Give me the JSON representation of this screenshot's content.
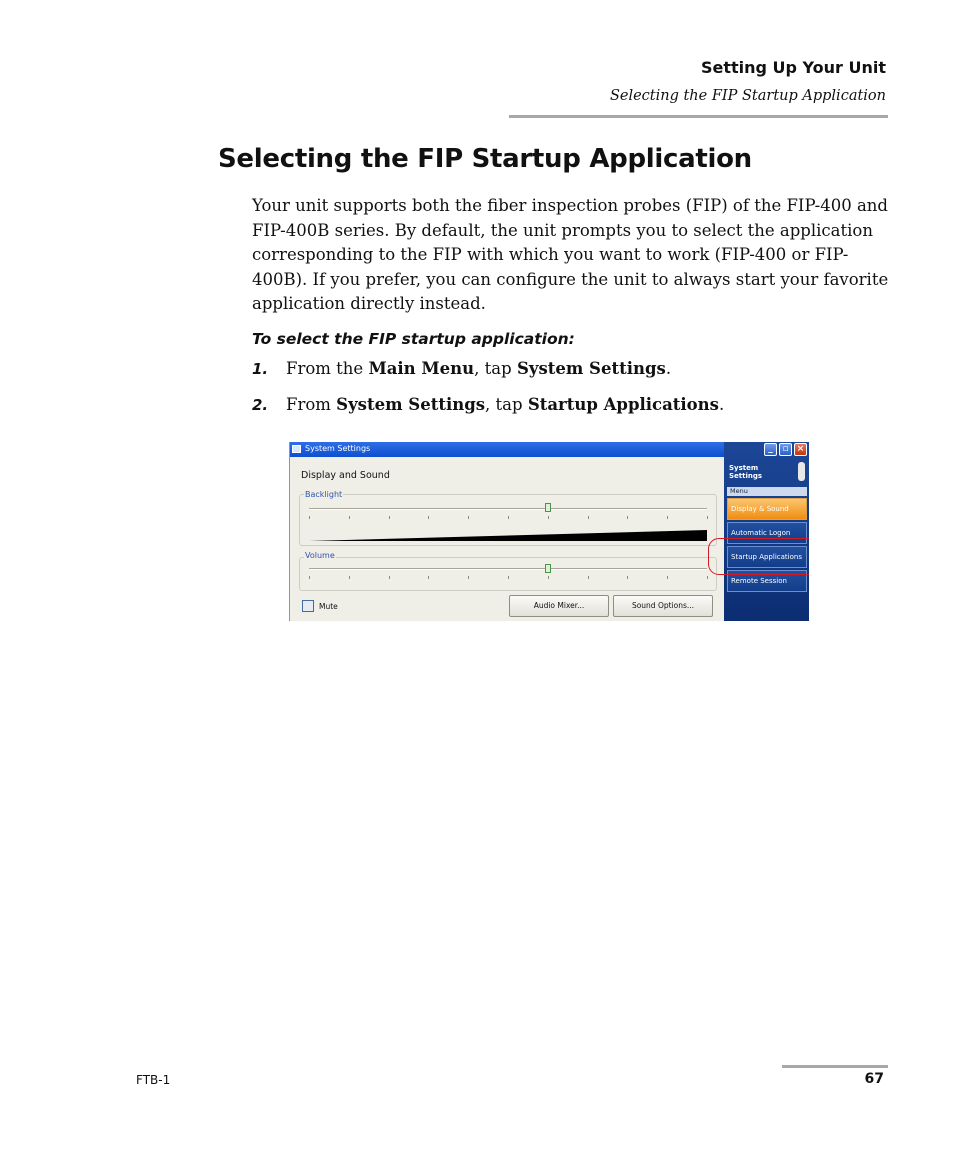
{
  "header": {
    "chapter": "Setting Up Your Unit",
    "section": "Selecting the FIP Startup Application"
  },
  "heading": "Selecting the FIP Startup Application",
  "intro": "Your unit supports both the fiber inspection probes (FIP) of the FIP-400 and FIP-400B series. By default, the unit prompts you to select the application corresponding to the FIP with which you want to work (FIP-400 or FIP-400B). If you prefer, you can configure the unit to always start your favorite application directly instead.",
  "procedure_title": "To select the FIP startup application:",
  "steps": [
    {
      "num": "1.",
      "pre": "From the ",
      "b1": "Main Menu",
      "mid": ", tap ",
      "b2": "System Settings",
      "end": "."
    },
    {
      "num": "2.",
      "pre": "From ",
      "b1": "System Settings",
      "mid": ", tap ",
      "b2": "Startup Applications",
      "end": "."
    }
  ],
  "screenshot": {
    "window_title": "System Settings",
    "section_title": "Display and Sound",
    "backlight_label": "Backlight",
    "volume_label": "Volume",
    "backlight_level": 0.6,
    "volume_level": 0.6,
    "mute_label": "Mute",
    "mute_checked": false,
    "audio_mixer_button": "Audio Mixer...",
    "sound_options_button": "Sound Options...",
    "sidebar_title": "System Settings",
    "menu_label": "Menu",
    "menu_items": [
      "Display & Sound",
      "Automatic Logon",
      "Startup Applications",
      "Remote Session"
    ],
    "active_item": "Display & Sound",
    "highlighted_item": "Startup Applications",
    "colors": {
      "titlebar": "#0c4fd0",
      "sidebar": "#0c2d72",
      "active_item": "#f08d12",
      "callout": "#d11b22"
    }
  },
  "footer": {
    "left": "FTB-1",
    "page_number": "67"
  }
}
